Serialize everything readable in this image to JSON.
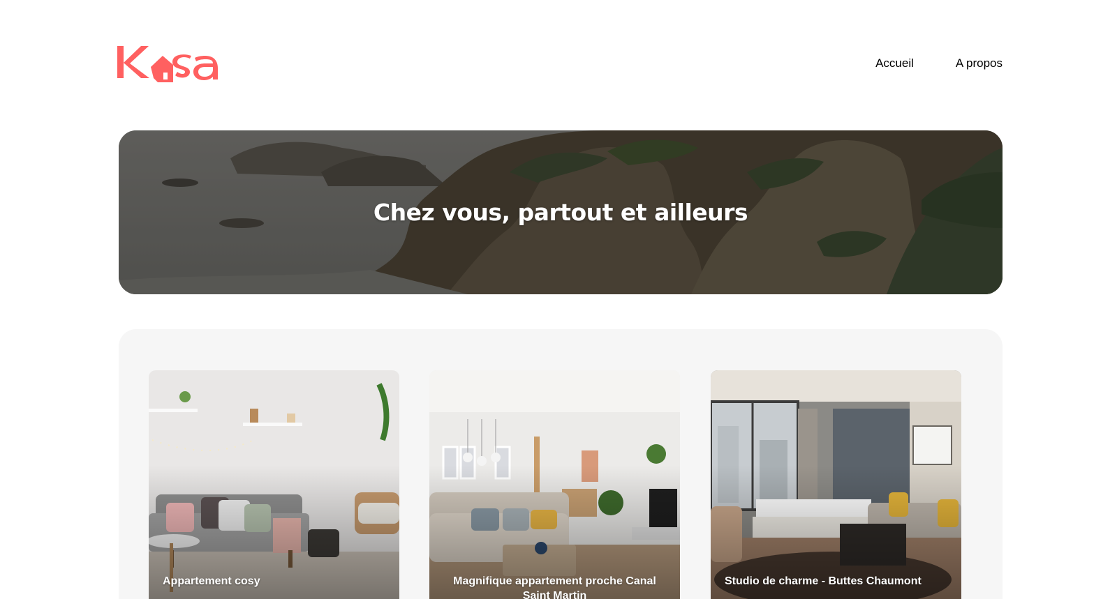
{
  "logo": {
    "text": "Kasa",
    "color": "#ff6060"
  },
  "nav": {
    "home_label": "Accueil",
    "about_label": "A propos"
  },
  "banner": {
    "title": "Chez vous, partout et ailleurs"
  },
  "listings": [
    {
      "title": "Appartement cosy"
    },
    {
      "title": "Magnifique appartement proche Canal Saint Martin"
    },
    {
      "title": "Studio de charme - Buttes Chaumont"
    }
  ],
  "colors": {
    "brand": "#ff6060",
    "gallery_bg": "#f6f6f6",
    "text": "#000000"
  }
}
